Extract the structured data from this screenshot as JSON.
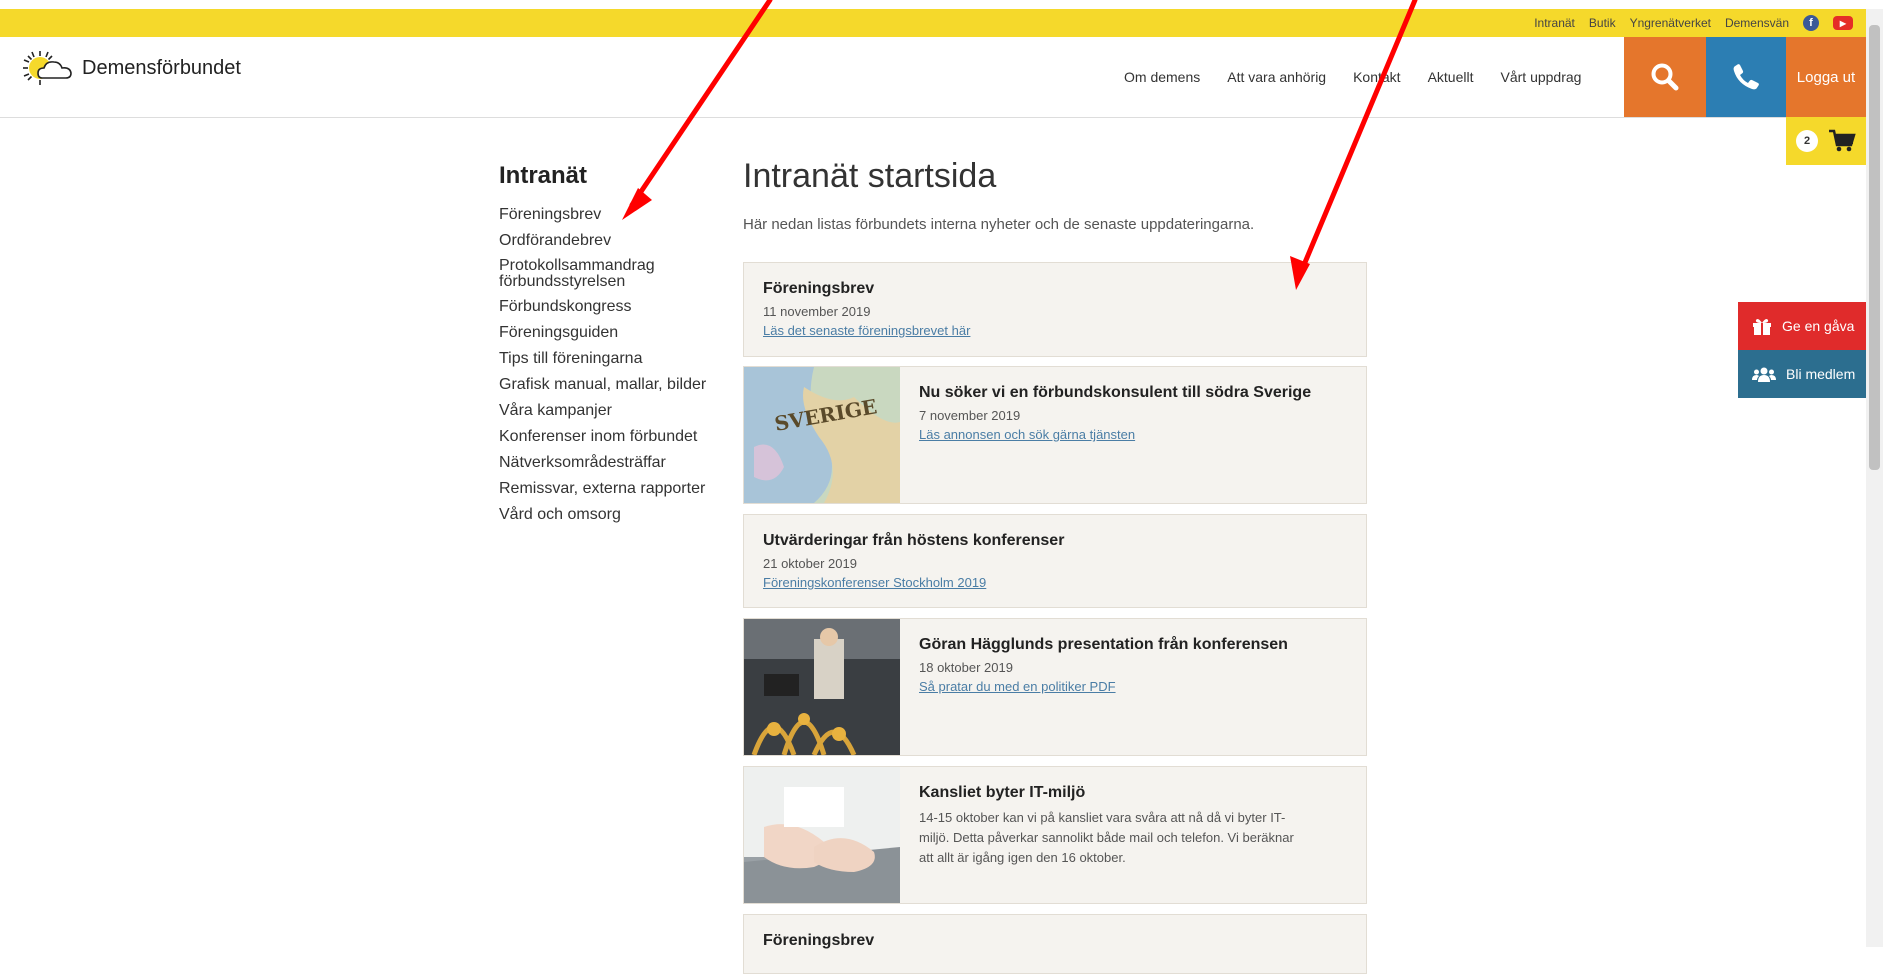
{
  "colors": {
    "topbar": "#f5d92b",
    "orange": "#e5762c",
    "blue": "#2c7eb3",
    "red": "#e02b2b",
    "teal": "#2c6e8f",
    "card_bg": "#f5f3ef",
    "link": "#4a7da5",
    "annotation_arrow": "#ff0000"
  },
  "toplinks": [
    "Intranät",
    "Butik",
    "Yngrenätverket",
    "Demensvän"
  ],
  "social": {
    "facebook": "facebook-icon",
    "youtube": "youtube-icon"
  },
  "logo_text": "Demensförbundet",
  "nav": [
    "Om demens",
    "Att vara anhörig",
    "Kontakt",
    "Aktuellt",
    "Vårt uppdrag"
  ],
  "login_label": "Logga ut",
  "cart_count": "2",
  "side_buttons": {
    "gift": "Ge en gåva",
    "member": "Bli medlem"
  },
  "sidebar": {
    "title": "Intranät",
    "items": [
      "Föreningsbrev",
      "Ordförandebrev",
      "Protokollsammandrag förbundsstyrelsen",
      "Förbundskongress",
      "Föreningsguiden",
      "Tips till föreningarna",
      "Grafisk manual, mallar, bilder",
      "Våra kampanjer",
      "Konferenser inom förbundet",
      "Nätverksområdesträffar",
      "Remissvar, externa rapporter",
      "Vård och omsorg"
    ]
  },
  "main": {
    "title": "Intranät startsida",
    "intro": "Här nedan listas förbundets interna nyheter och de senaste uppdateringarna.",
    "cards": [
      {
        "title": "Föreningsbrev",
        "date": "11 november 2019",
        "link": "Läs det senaste föreningsbrevet här"
      },
      {
        "title": "Nu söker vi en förbundskonsulent till södra Sverige",
        "date": "7 november 2019",
        "link": "Läs annonsen och sök gärna tjänsten"
      },
      {
        "title": "Utvärderingar från höstens konferenser",
        "date": "21 oktober 2019",
        "link": "Föreningskonferenser Stockholm 2019"
      },
      {
        "title": "Göran Hägglunds presentation från konferensen",
        "date": "18 oktober 2019",
        "link": "Så pratar du med en politiker PDF"
      },
      {
        "title": "Kansliet byter IT-miljö",
        "desc": "14-15 oktober kan vi på kansliet vara svåra att nå då vi byter IT-miljö. Detta påverkar sannolikt både mail och telefon. Vi beräknar att allt är igång igen den 16 oktober."
      },
      {
        "title": "Föreningsbrev"
      }
    ]
  }
}
